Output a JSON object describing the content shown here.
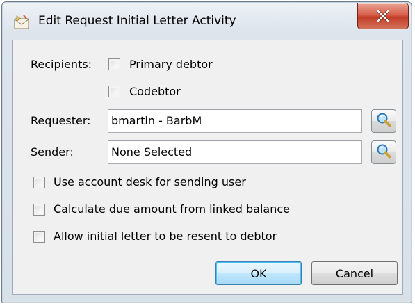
{
  "window": {
    "title": "Edit Request Initial Letter Activity"
  },
  "icons": {
    "title": "envelope-icon",
    "close": "close-icon",
    "lookup": "magnifier-icon"
  },
  "form": {
    "recipients_label": "Recipients:",
    "primary_debtor_label": "Primary debtor",
    "primary_debtor_checked": false,
    "codebtor_label": "Codebtor",
    "codebtor_checked": false,
    "requester_label": "Requester:",
    "requester_value": "bmartin - BarbM",
    "sender_label": "Sender:",
    "sender_value": "None Selected",
    "options": [
      {
        "label": "Use account desk for sending user",
        "checked": false
      },
      {
        "label": "Calculate due amount from linked balance",
        "checked": false
      },
      {
        "label": "Allow initial letter to be resent to debtor",
        "checked": false
      }
    ]
  },
  "buttons": {
    "ok_label": "OK",
    "cancel_label": "Cancel"
  },
  "colors": {
    "close_button": "#c94a33",
    "default_button_border": "#3c7fb1",
    "panel": "#f0f0f0"
  }
}
